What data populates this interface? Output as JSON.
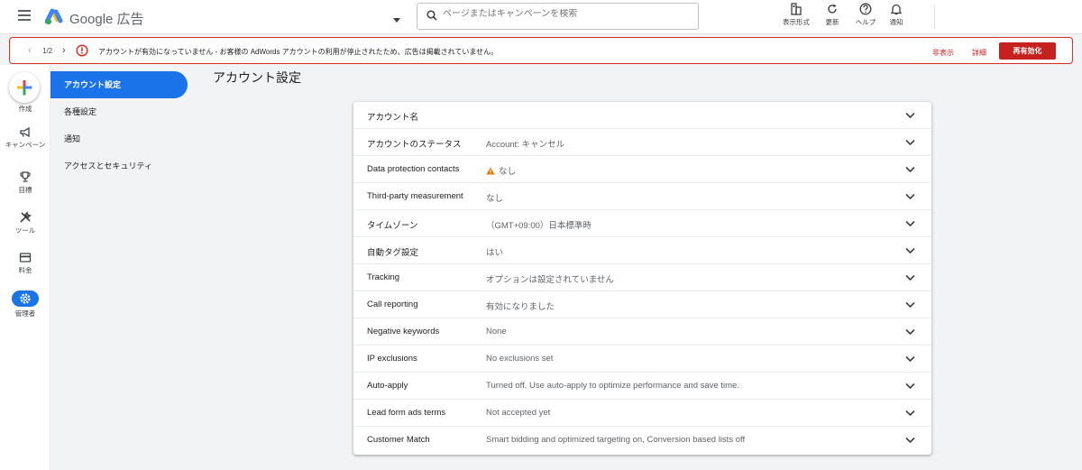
{
  "header": {
    "logo_text": "Google 広告",
    "search_placeholder": "ページまたはキャンペーンを検索",
    "buttons": [
      {
        "label": "表示形式",
        "icon": "view-format-icon"
      },
      {
        "label": "更新",
        "icon": "refresh-icon"
      },
      {
        "label": "ヘルプ",
        "icon": "help-icon"
      },
      {
        "label": "通知",
        "icon": "bell-icon"
      }
    ]
  },
  "alert": {
    "counter": "1/2",
    "message": "アカウントが有効になっていません - お客様の AdWords アカウントの利用が停止されたため、広告は掲載されていません。",
    "dismiss_label": "非表示",
    "details_label": "詳細",
    "reactivate_label": "再有効化",
    "colors": {
      "error": "#d93025",
      "button": "#c5221f"
    }
  },
  "rail": {
    "items": [
      {
        "label": "作成",
        "icon": "plus-icon"
      },
      {
        "label": "キャンペーン",
        "icon": "megaphone-icon"
      },
      {
        "label": "目標",
        "icon": "trophy-icon"
      },
      {
        "label": "ツール",
        "icon": "tools-icon"
      },
      {
        "label": "料金",
        "icon": "credit-card-icon"
      },
      {
        "label": "管理者",
        "icon": "gear-icon"
      }
    ]
  },
  "subnav": {
    "items": [
      {
        "label": "アカウント設定",
        "active": true
      },
      {
        "label": "各種設定",
        "active": false
      },
      {
        "label": "通知",
        "active": false
      },
      {
        "label": "アクセスとセキュリティ",
        "active": false
      }
    ],
    "accent": "#1a73e8"
  },
  "page": {
    "title": "アカウント設定"
  },
  "settings": {
    "rows": [
      {
        "label": "アカウント名",
        "value": ""
      },
      {
        "label": "アカウントのステータス",
        "value": "Account: キャンセル"
      },
      {
        "label": "Data protection contacts",
        "value": "なし"
      },
      {
        "label": "Third-party measurement",
        "value": "なし"
      },
      {
        "label": "タイムゾーン",
        "value": "（GMT+09:00）日本標準時"
      },
      {
        "label": "自動タグ設定",
        "value": "はい"
      },
      {
        "label": "Tracking",
        "value": "オプションは設定されていません"
      },
      {
        "label": "Call reporting",
        "value": "有効になりました"
      },
      {
        "label": "Negative keywords",
        "value": "None"
      },
      {
        "label": "IP exclusions",
        "value": "No exclusions set"
      },
      {
        "label": "Auto-apply",
        "value": "Turned off. Use auto-apply to optimize performance and save time."
      },
      {
        "label": "Lead form ads terms",
        "value": "Not accepted yet"
      },
      {
        "label": "Customer Match",
        "value": "Smart bidding and optimized targeting on, Conversion based lists off"
      }
    ]
  }
}
